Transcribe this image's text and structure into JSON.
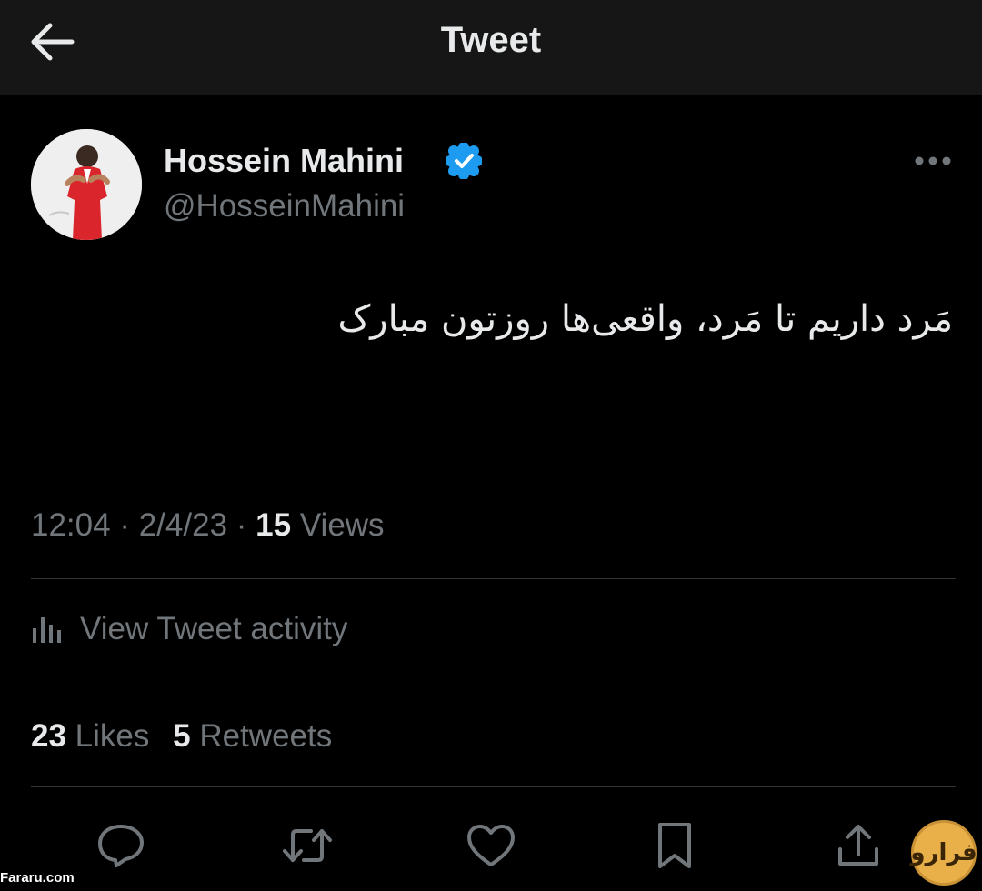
{
  "header": {
    "back_icon": "arrow-left-icon",
    "title": "Tweet"
  },
  "author": {
    "display_name": "Hossein Mahini",
    "handle": "@HosseinMahini",
    "verified_icon": "verified-badge-icon",
    "verified_color": "#1d9bf0"
  },
  "more_icon": "more-horizontal-icon",
  "tweet": {
    "text": "مَرد داریم تا مَرد، واقعی‌ها روزتون مبارک"
  },
  "meta": {
    "time": "12:04",
    "separator": "·",
    "date": "2/4/23",
    "views_count": "15",
    "views_label": "Views"
  },
  "activity": {
    "icon": "bar-chart-icon",
    "label": "View Tweet activity"
  },
  "stats": {
    "likes_count": "23",
    "likes_label": "Likes",
    "retweets_count": "5",
    "retweets_label": "Retweets"
  },
  "actions": [
    {
      "icon": "reply-icon"
    },
    {
      "icon": "retweet-icon"
    },
    {
      "icon": "like-icon"
    },
    {
      "icon": "bookmark-icon"
    },
    {
      "icon": "share-icon"
    }
  ],
  "watermark": {
    "site": "Fararu.com",
    "logo_text": "فرارو"
  },
  "colors": {
    "background": "#000000",
    "header_bg": "#161616",
    "primary_text": "#e7e9ea",
    "secondary_text": "#71767b",
    "divider": "#2f3336",
    "accent": "#1d9bf0"
  }
}
